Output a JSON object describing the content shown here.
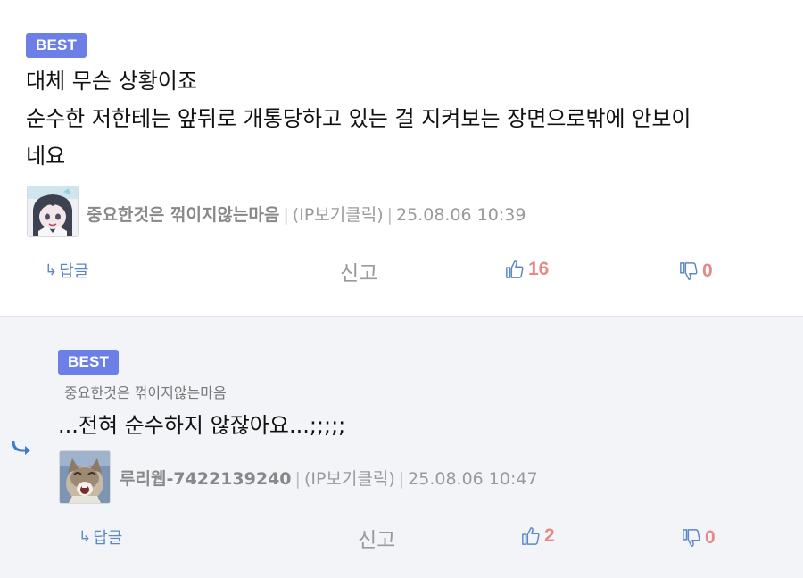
{
  "comment1": {
    "badge": "BEST",
    "lines": [
      "대체 무슨 상황이죠",
      "순수한 저한테는 앞뒤로 개통당하고 있는 걸 지켜보는 장면으로밖에 안보이",
      "네요"
    ],
    "author": "중요한것은 꺾이지않는마음",
    "ip": "(IP보기클릭)",
    "datetime": "25.08.06 10:39",
    "reply_label": "답글",
    "report_label": "신고",
    "likes": "16",
    "dislikes": "0"
  },
  "comment2": {
    "badge": "BEST",
    "reply_to": "중요한것은 꺾이지않는마음",
    "text": "...전혀 순수하지 않잖아요...;;;;;",
    "author": "루리웹-7422139240",
    "ip": "(IP보기클릭)",
    "datetime": "25.08.06 10:47",
    "reply_label": "답글",
    "report_label": "신고",
    "likes": "2",
    "dislikes": "0"
  },
  "colors": {
    "badge": "#6b7fe6",
    "count": "#e58a8a",
    "icon": "#5c86cc",
    "reply_bg": "#f3f4f8"
  },
  "icons": [
    "reply-arrow-icon",
    "thumbs-up-icon",
    "thumbs-down-icon",
    "nested-reply-arrow-icon"
  ]
}
